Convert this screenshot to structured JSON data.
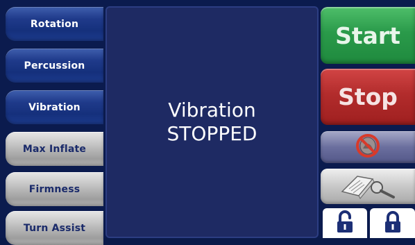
{
  "left_menu": {
    "items": [
      {
        "label": "Rotation",
        "style": "blue"
      },
      {
        "label": "Percussion",
        "style": "blue"
      },
      {
        "label": "Vibration",
        "style": "blue"
      },
      {
        "label": "Max Inflate",
        "style": "gray"
      },
      {
        "label": "Firmness",
        "style": "gray"
      },
      {
        "label": "Turn Assist",
        "style": "gray"
      }
    ]
  },
  "status": {
    "line1": "Vibration",
    "line2": "STOPPED"
  },
  "controls": {
    "start_label": "Start",
    "stop_label": "Stop",
    "mute_icon": "alarm-silence-icon",
    "manual_icon": "manual-search-icon",
    "unlock_icon": "unlocked-padlock-icon",
    "lock_icon": "locked-padlock-icon"
  },
  "colors": {
    "background": "#0b1b4e",
    "panel": "#1e2a63",
    "start": "#2a9a4a",
    "stop": "#b22c2c"
  }
}
